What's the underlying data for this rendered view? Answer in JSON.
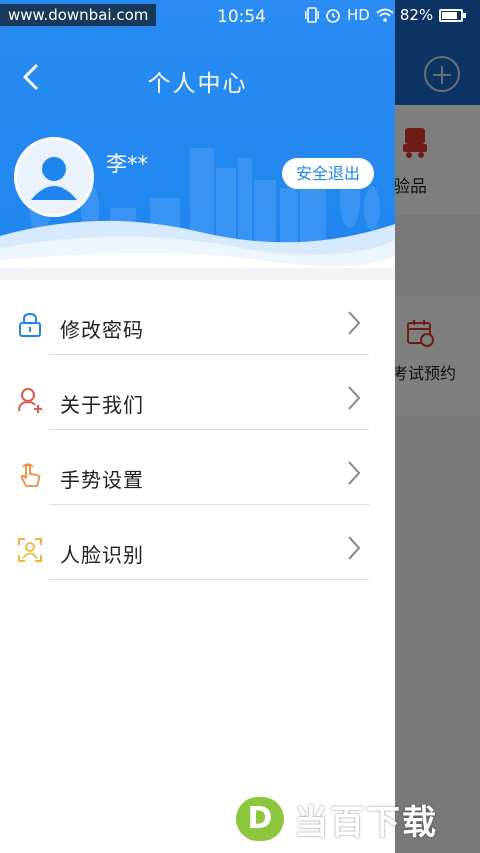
{
  "status_bar": {
    "watermark": "www.downbai.com",
    "time": "10:54",
    "network": "HD",
    "battery": "82%",
    "battery_level": 0.82
  },
  "background_app": {
    "item1_label": "验品",
    "item2_label": "考试预约"
  },
  "drawer": {
    "title": "个人中心",
    "username": "李**",
    "logout_label": "安全退出",
    "menu": [
      {
        "label": "修改密码",
        "icon": "lock-icon"
      },
      {
        "label": "关于我们",
        "icon": "user-add-icon"
      },
      {
        "label": "手势设置",
        "icon": "hand-tap-icon"
      },
      {
        "label": "人脸识别",
        "icon": "face-scan-icon"
      }
    ]
  },
  "watermark_logo": {
    "letter": "D",
    "text": "当百下载"
  },
  "colors": {
    "primary_blue": "#1f85ee",
    "header_bg_app": "#1a66c7",
    "logo_green": "#8cc63f"
  }
}
